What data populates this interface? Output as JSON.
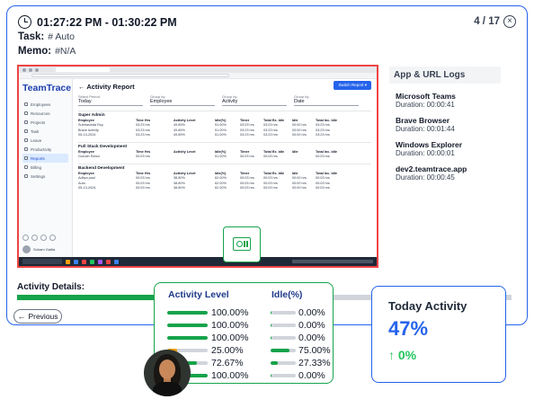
{
  "header": {
    "time_range": "01:27:22 PM - 01:30:22 PM",
    "task_label": "Task:",
    "task_value": "# Auto",
    "memo_label": "Memo:",
    "memo_value": "#N/A",
    "counter": "4 / 17"
  },
  "screenshot": {
    "logo": "TeamTrace",
    "page_title": "Activity Report",
    "switch_button": "Switch Report",
    "sidebar_items": [
      "Employees",
      "Resources",
      "Projects",
      "Task",
      "Leave",
      "Productivity",
      "Reports",
      "Billing",
      "Settings"
    ],
    "active_item": "Reports",
    "user_name": "Soham Gaitla",
    "filters": [
      {
        "label": "Select Period",
        "value": "Today"
      },
      {
        "label": "Group by",
        "value": "Employee"
      },
      {
        "label": "Group by",
        "value": "Activity"
      },
      {
        "label": "Group by",
        "value": "Date"
      }
    ],
    "columns": [
      "Employee",
      "Time Hrs",
      "Activity Level",
      "Idle(%)",
      "Timer",
      "Total Ex. Idle",
      "Idle",
      "Total Inc. Idle"
    ],
    "groups": [
      {
        "name": "Super Admin",
        "rows": [
          [
            "Subhasinda Roy",
            "03:23 hrs",
            "49.89%",
            "51.00%",
            "03:23 hrs",
            "03:23 hrs",
            "00:00 hrs",
            "03:23 hrs"
          ],
          [
            "Brave Activity",
            "03:23 hrs",
            "49.89%",
            "51.00%",
            "03:23 hrs",
            "03:23 hrs",
            "00:00 hrs",
            "03:23 hrs"
          ],
          [
            "05-13-2024",
            "03:23 hrs",
            "49.89%",
            "51.00%",
            "03:23 hrs",
            "03:23 hrs",
            "00:00 hrs",
            "03:23 hrs"
          ]
        ]
      },
      {
        "name": "Full Stack Development",
        "rows": [
          [
            "Employee",
            "Time Hrs",
            "Activity Level",
            "Idle(%)",
            "Timer",
            "Total Ex. Idle",
            "Idle",
            "Total Inc. Idle"
          ],
          [
            "Gurubh Rahul",
            "00:03 hrs",
            "",
            "51.00%",
            "00:03 hrs",
            "00:03 hrs",
            "",
            "00:03 hrs"
          ]
        ]
      },
      {
        "name": "Backend Development",
        "rows": [
          [
            "Aditya paul",
            "00:03 hrs",
            "38.80%",
            "62.00%",
            "00:03 hrs",
            "00:03 hrs",
            "00:00 hrs",
            "00:03 hrs"
          ],
          [
            "Auto",
            "00:03 hrs",
            "38.80%",
            "62.00%",
            "00:03 hrs",
            "00:03 hrs",
            "00:00 hrs",
            "00:03 hrs"
          ],
          [
            "05-13-2024",
            "00:03 hrs",
            "38.80%",
            "62.00%",
            "00:03 hrs",
            "00:03 hrs",
            "00:00 hrs",
            "00:03 hrs"
          ]
        ]
      }
    ]
  },
  "logs": {
    "title": "App & URL Logs",
    "items": [
      {
        "app": "Microsoft Teams",
        "duration": "Duration: 00:00:41"
      },
      {
        "app": "Brave Browser",
        "duration": "Duration: 00:01:44"
      },
      {
        "app": "Windows Explorer",
        "duration": "Duration: 00:00:01"
      },
      {
        "app": "dev2.teamtrace.app",
        "duration": "Duration: 00:00:45"
      }
    ]
  },
  "activity": {
    "label": "Activity Details:",
    "fill": 0.63
  },
  "nav": {
    "previous": "Previous"
  },
  "stats": {
    "col1": "Activity Level",
    "col2": "Idle(%)",
    "rows": [
      {
        "activity": "100.00%",
        "activity_frac": 1.0,
        "activity_color": "#16a34a",
        "idle": "0.00%",
        "idle_frac": 0.05
      },
      {
        "activity": "100.00%",
        "activity_frac": 1.0,
        "activity_color": "#16a34a",
        "idle": "0.00%",
        "idle_frac": 0.05
      },
      {
        "activity": "100.00%",
        "activity_frac": 1.0,
        "activity_color": "#16a34a",
        "idle": "0.00%",
        "idle_frac": 0.05
      },
      {
        "activity": "25.00%",
        "activity_frac": 0.25,
        "activity_color": "#f59e0b",
        "idle": "75.00%",
        "idle_frac": 0.75
      },
      {
        "activity": "72.67%",
        "activity_frac": 0.73,
        "activity_color": "#16a34a",
        "idle": "27.33%",
        "idle_frac": 0.27
      },
      {
        "activity": "100.00%",
        "activity_frac": 1.0,
        "activity_color": "#16a34a",
        "idle": "0.00%",
        "idle_frac": 0.05
      }
    ]
  },
  "today": {
    "title": "Today Activity",
    "percent": "47%",
    "delta_arrow": "↑",
    "delta": "0%"
  },
  "colors": {
    "accent": "#2563eb",
    "success": "#16a34a",
    "warning": "#f59e0b"
  }
}
